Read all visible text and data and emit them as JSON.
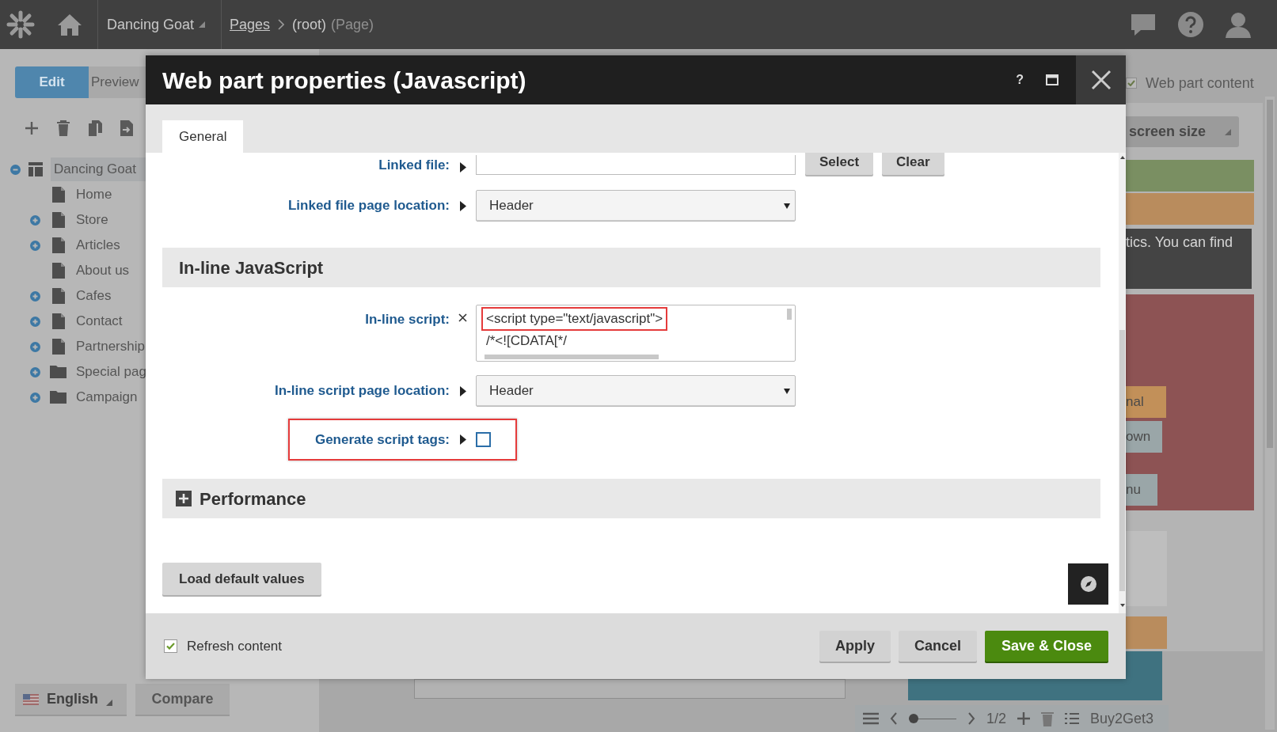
{
  "top_bar": {
    "site": "Dancing Goat",
    "breadcrumb": [
      {
        "text": "Pages",
        "kind": "link"
      },
      {
        "text": "(root)",
        "kind": "current"
      }
    ],
    "page_type": "(Page)"
  },
  "mode_tabs": [
    {
      "label": "Edit",
      "selected": true
    },
    {
      "label": "Preview",
      "selected": false
    }
  ],
  "tree": {
    "label": "Dancing Goat",
    "kind": "template",
    "expanded": true,
    "selected": true,
    "children": [
      {
        "label": "Home",
        "kind": "page",
        "has_children": false
      },
      {
        "label": "Store",
        "kind": "page",
        "has_children": true
      },
      {
        "label": "Articles",
        "kind": "page",
        "has_children": true
      },
      {
        "label": "About us",
        "kind": "page",
        "has_children": false
      },
      {
        "label": "Cafes",
        "kind": "page",
        "has_children": true
      },
      {
        "label": "Contact",
        "kind": "page",
        "has_children": true
      },
      {
        "label": "Partnership",
        "kind": "page",
        "has_children": true
      },
      {
        "label": "Special pag",
        "kind": "folder",
        "has_children": true
      },
      {
        "label": "Campaign",
        "kind": "folder",
        "has_children": true
      }
    ]
  },
  "language": "English",
  "compare": "Compare",
  "web_part_content": {
    "label": "Web part content",
    "checked": true
  },
  "device_dropdown": "screen size",
  "page_preview": {
    "banner_text": "tics. You can find",
    "menu_items": [
      {
        "text": "nal",
        "color": "#c29059"
      },
      {
        "text": "own",
        "color": "#9aa6a8"
      },
      {
        "text": "nu",
        "color": "#9aa6a8"
      }
    ]
  },
  "bottom_toolbar": {
    "slider": {
      "level": 0
    },
    "page": "1/2",
    "variant": "Buy2Get3"
  },
  "dialog": {
    "title": "Web part properties (Javascript)",
    "help": "?",
    "tabs": [
      {
        "label": "General",
        "selected": true
      }
    ],
    "fields": [
      {
        "kind": "file",
        "label": "Linked file:",
        "buttons": [
          "Select",
          "Clear"
        ]
      },
      {
        "kind": "select",
        "label": "Linked file page location:",
        "value": "Header"
      }
    ],
    "sections": [
      {
        "title": "In-line JavaScript",
        "expanded": true,
        "fields": [
          {
            "kind": "code",
            "label": "In-line script:",
            "lines": [
              "<script type=\"text/javascript\">",
              "/*<![CDATA[*/"
            ],
            "highlighted": true
          },
          {
            "kind": "select",
            "label": "In-line script page location:",
            "value": "Header"
          },
          {
            "kind": "checkbox",
            "label": "Generate script tags:",
            "checked": false,
            "highlighted": true
          }
        ]
      },
      {
        "title": "Performance",
        "expanded": false
      }
    ],
    "load_defaults": "Load default values",
    "footer": {
      "refresh": {
        "label": "Refresh content",
        "checked": true
      },
      "buttons": [
        {
          "label": "Apply",
          "kind": "secondary"
        },
        {
          "label": "Cancel",
          "kind": "secondary"
        },
        {
          "label": "Save & Close",
          "kind": "primary"
        }
      ]
    }
  }
}
